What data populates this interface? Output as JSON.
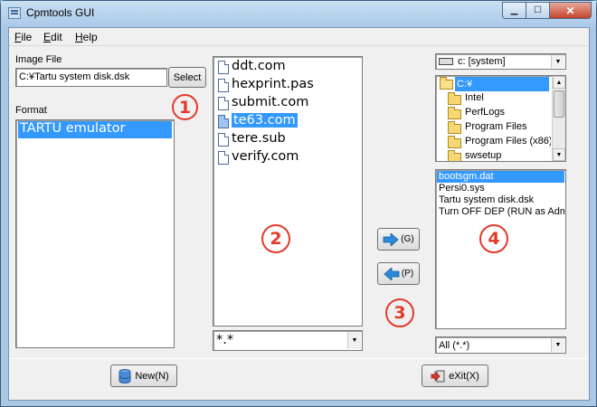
{
  "window": {
    "title": "Cpmtools GUI"
  },
  "menu": [
    {
      "label": "File",
      "key": "F",
      "rest": "ile"
    },
    {
      "label": "Edit",
      "key": "E",
      "rest": "dit"
    },
    {
      "label": "Help",
      "key": "H",
      "rest": "elp"
    }
  ],
  "image_file": {
    "label": "Image File",
    "value": "C:¥Tartu system disk.dsk",
    "select_label": "Select"
  },
  "format": {
    "label": "Format",
    "items": [
      "TARTU emulator"
    ],
    "selected": 0
  },
  "image_files": {
    "items": [
      "ddt.com",
      "hexprint.pas",
      "submit.com",
      "te63.com",
      "tere.sub",
      "verify.com"
    ],
    "selected": 3,
    "filter": "*.*"
  },
  "transfer": {
    "get_label": "(G)",
    "put_label": "(P)"
  },
  "local": {
    "drive": "c: [system]",
    "folders": [
      {
        "label": "C:¥",
        "open": true,
        "selected": true
      },
      {
        "label": "Intel"
      },
      {
        "label": "PerfLogs"
      },
      {
        "label": "Program Files"
      },
      {
        "label": "Program Files (x86)"
      },
      {
        "label": "swsetup"
      }
    ],
    "files": [
      "bootsgm.dat",
      "Persi0.sys",
      "Tartu system disk.dsk",
      "Turn OFF DEP (RUN as Admin)"
    ],
    "selected_file": 0,
    "filter": "All (*.*)"
  },
  "markers": [
    "1",
    "2",
    "3",
    "4"
  ],
  "bottom": {
    "new_label": "New(N)",
    "exit_label": "eXit(X)"
  },
  "colors": {
    "selection": "#3399ff",
    "marker": "#e23a2a"
  }
}
